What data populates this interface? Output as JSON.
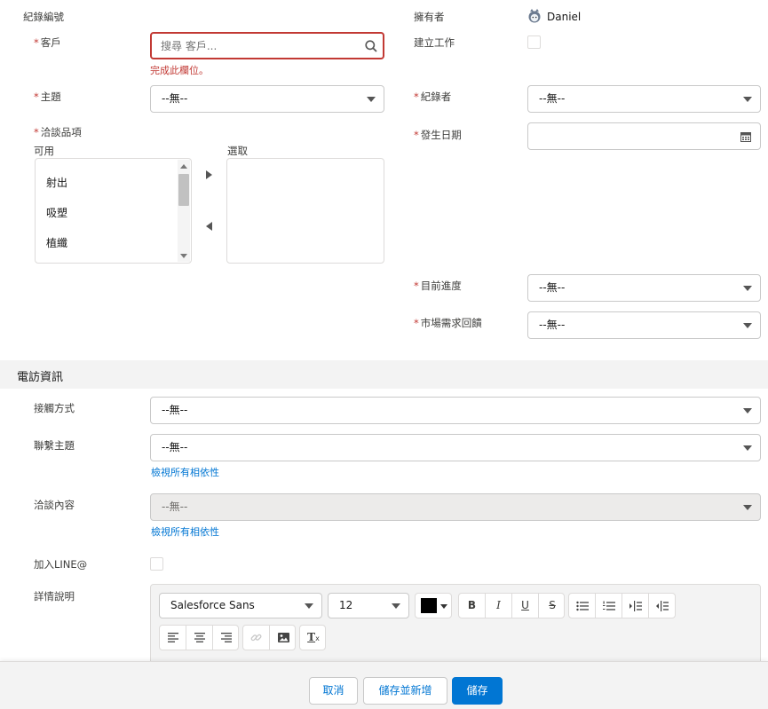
{
  "form": {
    "record_no_label": "紀錄編號",
    "customer_label": "客戶",
    "customer_placeholder": "搜尋 客戶...",
    "customer_error": "完成此欄位。",
    "subject_label": "主題",
    "subject_value": "--無--",
    "products_label": "洽談品項",
    "available_label": "可用",
    "selected_label": "選取",
    "available_options": [
      "射出",
      "吸塑",
      "植纖"
    ],
    "owner_label": "擁有者",
    "owner_name": "Daniel",
    "create_task_label": "建立工作",
    "recorder_label": "紀錄者",
    "recorder_value": "--無--",
    "date_label": "發生日期",
    "progress_label": "目前進度",
    "progress_value": "--無--",
    "market_label": "市場需求回饋",
    "market_value": "--無--"
  },
  "section": {
    "title": "電訪資訊",
    "contact_method_label": "接觸方式",
    "contact_method_value": "--無--",
    "contact_topic_label": "聯繫主題",
    "contact_topic_value": "--無--",
    "deps_link_1": "檢視所有相依性",
    "content_label": "洽談內容",
    "content_value": "--無--",
    "deps_link_2": "檢視所有相依性",
    "line_label": "加入LINE@",
    "details_label": "詳情說明"
  },
  "editor": {
    "font_value": "Salesforce Sans",
    "size_value": "12",
    "color": "#000000"
  },
  "footer": {
    "cancel": "取消",
    "save_new": "儲存並新增",
    "save": "儲存"
  },
  "colors": {
    "brand": "#0176d3",
    "error": "#c23934"
  }
}
